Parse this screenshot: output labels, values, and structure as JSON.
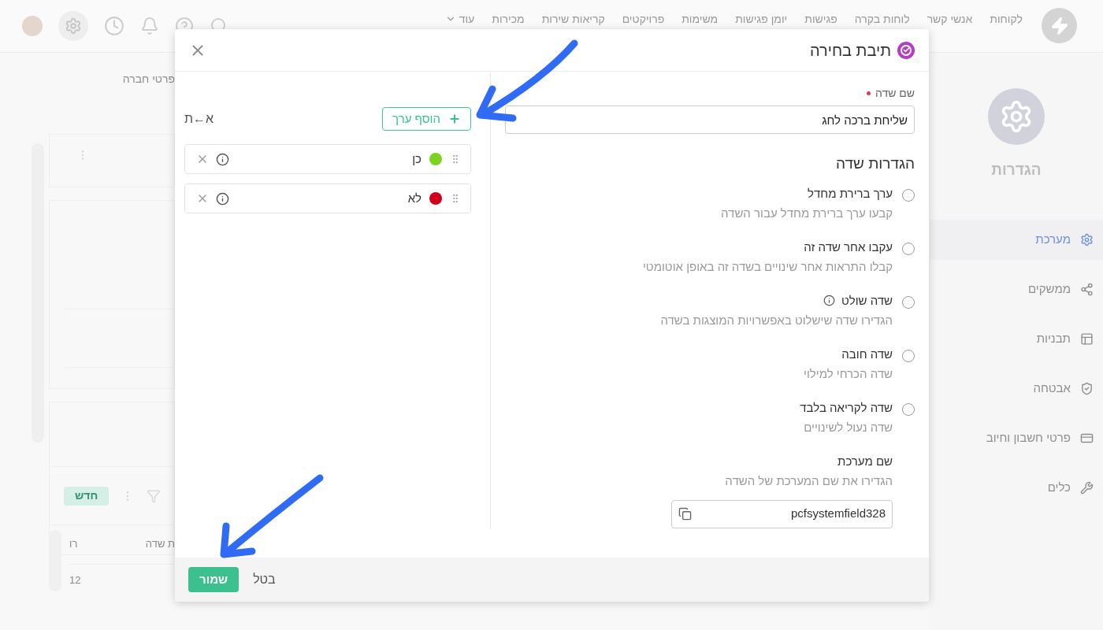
{
  "topbar": {
    "nav": [
      {
        "label": "לקוחות"
      },
      {
        "label": "אנשי קשר"
      },
      {
        "label": "לוחות בקרה"
      },
      {
        "label": "פגישות"
      },
      {
        "label": "יומן פגישות"
      },
      {
        "label": "משימות"
      },
      {
        "label": "פרויקטים"
      },
      {
        "label": "קריאות שירות"
      },
      {
        "label": "מכירות"
      },
      {
        "label": "עוד"
      }
    ]
  },
  "sidebar": {
    "title": "הגדרות",
    "items": [
      {
        "label": "מערכת",
        "kind": "gear",
        "selected": true
      },
      {
        "label": "ממשקים",
        "kind": "share",
        "selected": false
      },
      {
        "label": "תבניות",
        "kind": "layout",
        "selected": false
      },
      {
        "label": "אבטחה",
        "kind": "shield",
        "selected": false
      },
      {
        "label": "פרטי חשבון וחיוב",
        "kind": "card",
        "selected": false
      },
      {
        "label": "כלים",
        "kind": "tools",
        "selected": false
      }
    ]
  },
  "background": {
    "breadcrumb": "פרטי חברה",
    "new_button": "חדש",
    "table": {
      "columns": [
        "ת שדה",
        "רו"
      ],
      "rows": [
        [
          null,
          "12"
        ]
      ]
    }
  },
  "dialog": {
    "title": "תיבת בחירה",
    "field_name": {
      "label": "שם שדה",
      "required": true,
      "value": "שליחת ברכה לחג"
    },
    "settings_title": "הגדרות שדה",
    "options": [
      {
        "title": "ערך ברירת מחדל",
        "description": "קבעו ערך ברירת מחדל עבור השדה",
        "checked": false,
        "info": false
      },
      {
        "title": "עקבו אחר שדה זה",
        "description": "קבלו התראות אחר שינויים בשדה זה באופן אוטומטי",
        "checked": false,
        "info": false
      },
      {
        "title": "שדה שולט",
        "description": "הגדירו שדה שישלוט באפשרויות המוצגות בשדה",
        "checked": false,
        "info": true
      },
      {
        "title": "שדה חובה",
        "description": "שדה הכרחי למילוי",
        "checked": false,
        "info": false
      },
      {
        "title": "שדה לקריאה בלבד",
        "description": "שדה נעול לשינויים",
        "checked": false,
        "info": false
      }
    ],
    "system_name": {
      "title": "שם מערכת",
      "description": "הגדירו את שם המערכת של השדה",
      "value": "pcfsystemfield328"
    },
    "add_value_button": "הוסף ערך",
    "sort": "א←ת",
    "values": [
      {
        "label": "כן",
        "color": "#7ed321"
      },
      {
        "label": "לא",
        "color": "#d0021b"
      }
    ],
    "save_button": "שמור",
    "cancel_button": "בטל"
  }
}
